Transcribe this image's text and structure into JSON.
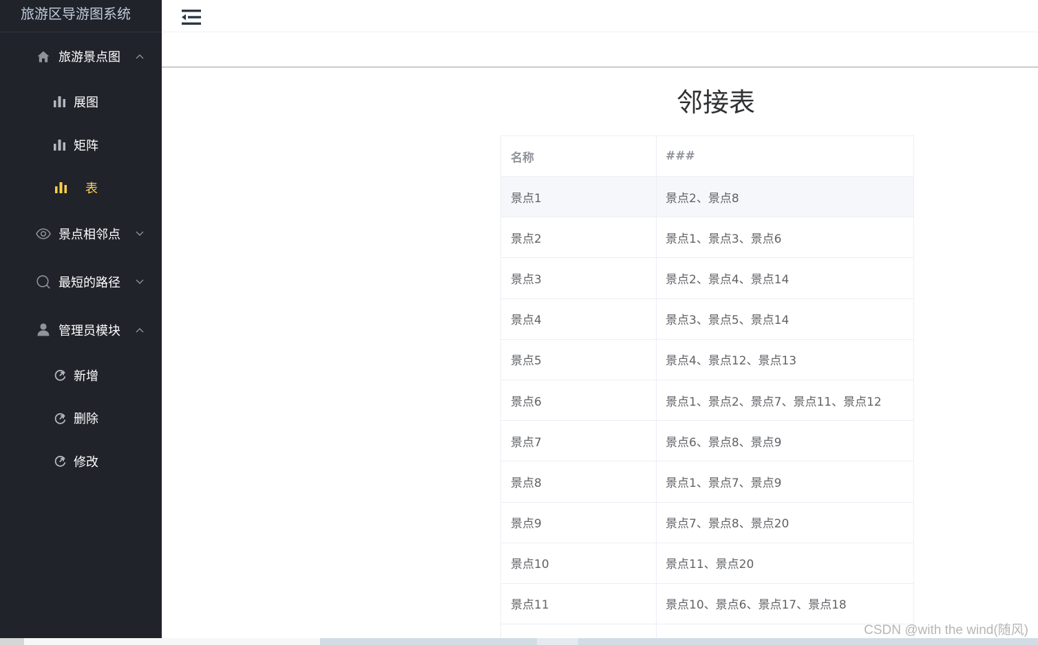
{
  "sidebar": {
    "title": "旅游区导游图系统",
    "menus": [
      {
        "label": "旅游景点图",
        "icon": "home-icon",
        "expanded": true,
        "children": [
          {
            "label": "展图",
            "icon": "bar-chart-icon",
            "active": false
          },
          {
            "label": "矩阵",
            "icon": "bar-chart-icon",
            "active": false
          },
          {
            "label": "表",
            "icon": "bar-chart-icon",
            "active": true
          }
        ]
      },
      {
        "label": "景点相邻点",
        "icon": "eye-icon",
        "expanded": false
      },
      {
        "label": "最短的路径",
        "icon": "search-icon",
        "expanded": false
      },
      {
        "label": "管理员模块",
        "icon": "user-icon",
        "expanded": true,
        "children": [
          {
            "label": "新增",
            "icon": "refresh-icon",
            "active": false
          },
          {
            "label": "删除",
            "icon": "refresh-icon",
            "active": false
          },
          {
            "label": "修改",
            "icon": "refresh-icon",
            "active": false
          }
        ]
      }
    ]
  },
  "header": {
    "toggle_icon": "fold-icon"
  },
  "main": {
    "title": "邻接表",
    "table": {
      "columns": [
        "名称",
        "###"
      ],
      "rows": [
        {
          "name": "景点1",
          "neighbors": "景点2、景点8",
          "highlighted": true
        },
        {
          "name": "景点2",
          "neighbors": "景点1、景点3、景点6",
          "highlighted": false
        },
        {
          "name": "景点3",
          "neighbors": "景点2、景点4、景点14",
          "highlighted": false
        },
        {
          "name": "景点4",
          "neighbors": "景点3、景点5、景点14",
          "highlighted": false
        },
        {
          "name": "景点5",
          "neighbors": "景点4、景点12、景点13",
          "highlighted": false
        },
        {
          "name": "景点6",
          "neighbors": "景点1、景点2、景点7、景点11、景点12",
          "highlighted": false
        },
        {
          "name": "景点7",
          "neighbors": "景点6、景点8、景点9",
          "highlighted": false
        },
        {
          "name": "景点8",
          "neighbors": "景点1、景点7、景点9",
          "highlighted": false
        },
        {
          "name": "景点9",
          "neighbors": "景点7、景点8、景点20",
          "highlighted": false
        },
        {
          "name": "景点10",
          "neighbors": "景点11、景点20",
          "highlighted": false
        },
        {
          "name": "景点11",
          "neighbors": "景点10、景点6、景点17、景点18",
          "highlighted": false
        }
      ]
    }
  },
  "watermark": "CSDN @with the wind(随风)",
  "colors": {
    "sidebar_bg": "#20232a",
    "menu_text": "#ffffff",
    "menu_active": "#ffd04b",
    "icon": "#909399",
    "table_header_text": "#909399",
    "table_cell_text": "#606266",
    "table_border": "#ebeef5",
    "hover_row_bg": "#f5f7fa"
  }
}
